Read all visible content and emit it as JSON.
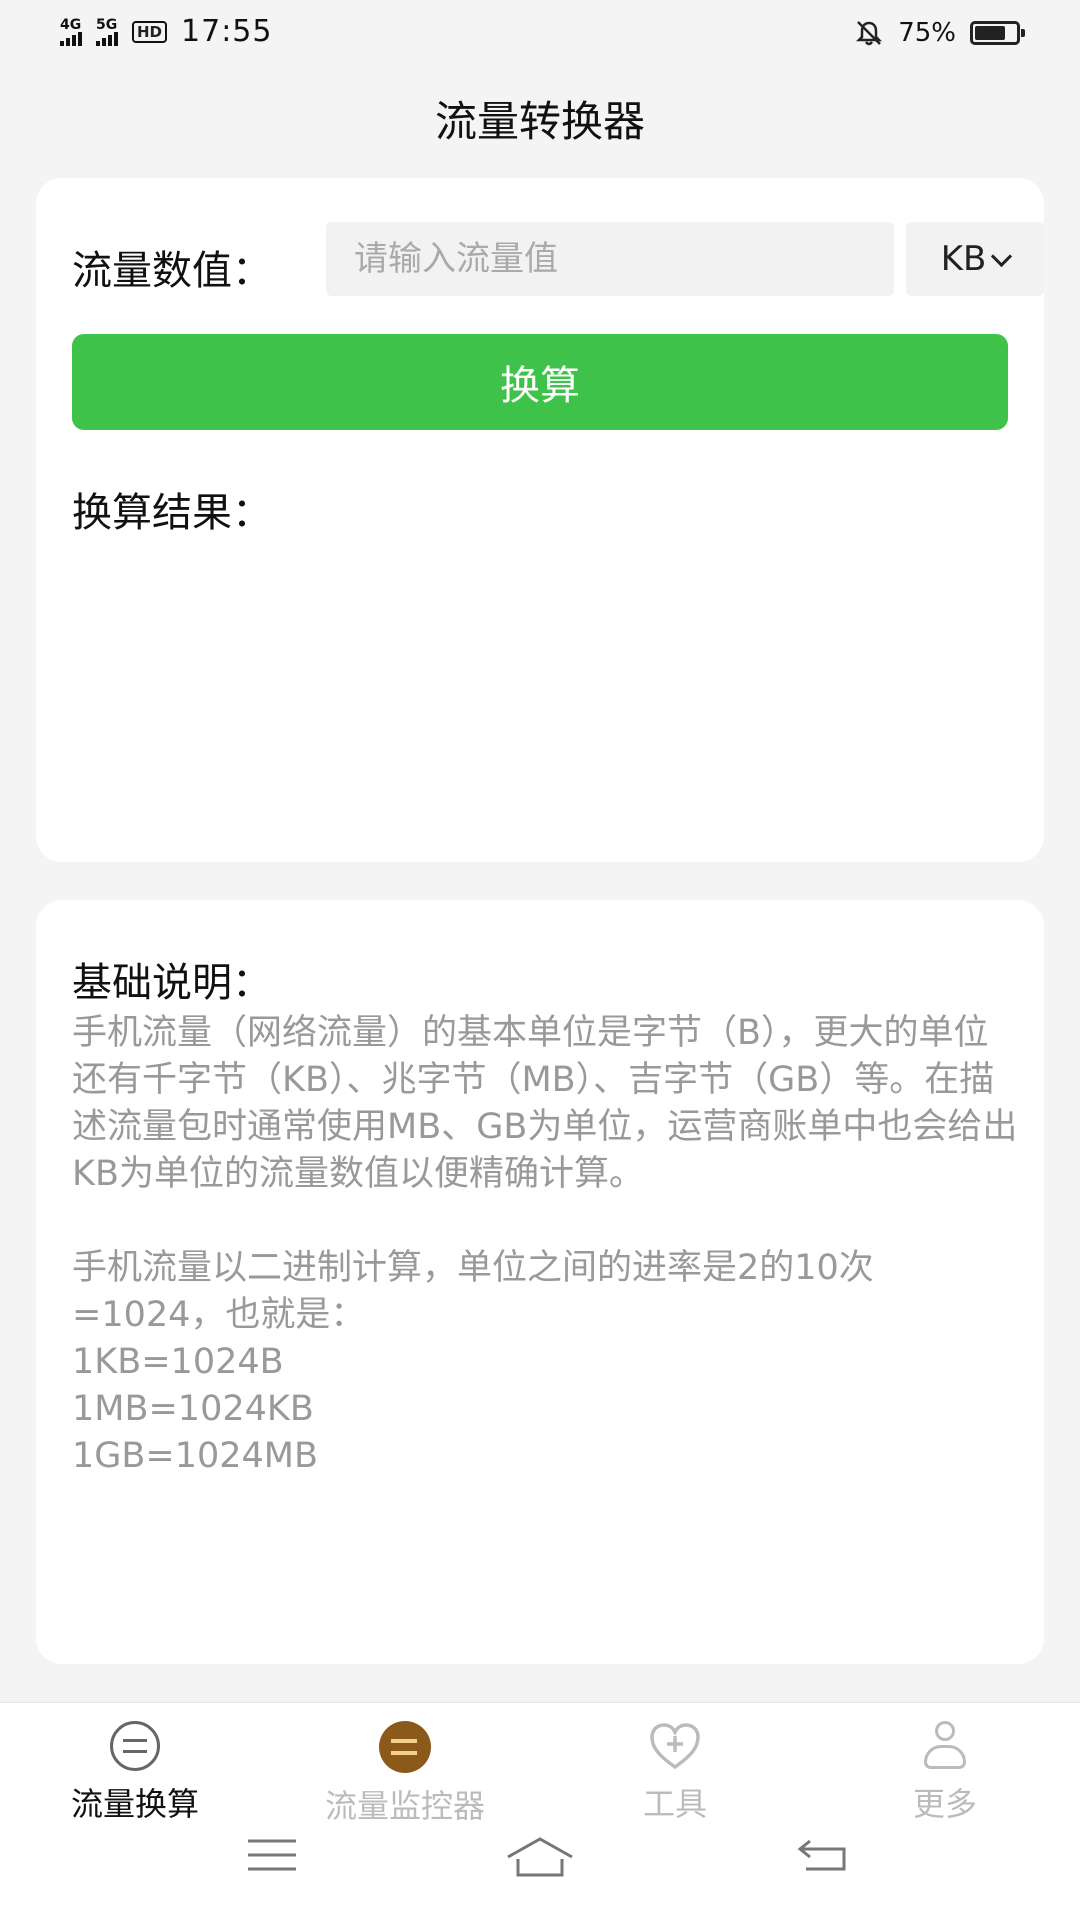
{
  "status_bar": {
    "net1": "4G",
    "net2": "5G",
    "hd": "HD",
    "time": "17:55",
    "battery_pct": "75%",
    "battery_level": 0.75
  },
  "header": {
    "title": "流量转换器"
  },
  "converter": {
    "input_label": "流量数值：",
    "input_placeholder": "请输入流量值",
    "input_value": "",
    "unit_selected": "KB",
    "convert_button": "换算",
    "result_label": "换算结果："
  },
  "info": {
    "title": "基础说明：",
    "paragraph1": "手机流量（网络流量）的基本单位是字节（B），更大的单位还有千字节（KB）、兆字节（MB）、吉字节（GB）等。在描述流量包时通常使用MB、GB为单位，运营商账单中也会给出KB为单位的流量数值以便精确计算。",
    "paragraph2": "手机流量以二进制计算，单位之间的进率是2的10次=1024，也就是：",
    "formula1": "1KB=1024B",
    "formula2": "1MB=1024KB",
    "formula3": "1GB=1024MB"
  },
  "bottom_nav": {
    "items": [
      {
        "label": "流量换算",
        "icon": "swap-icon",
        "active": true
      },
      {
        "label": "流量监控器",
        "icon": "monitor-icon",
        "active": false
      },
      {
        "label": "工具",
        "icon": "heart-plus-icon",
        "active": false
      },
      {
        "label": "更多",
        "icon": "user-icon",
        "active": false
      }
    ]
  },
  "colors": {
    "accent_green": "#3fc24a",
    "monitor_brown": "#8b5a1b",
    "background": "#f4f4f4"
  }
}
